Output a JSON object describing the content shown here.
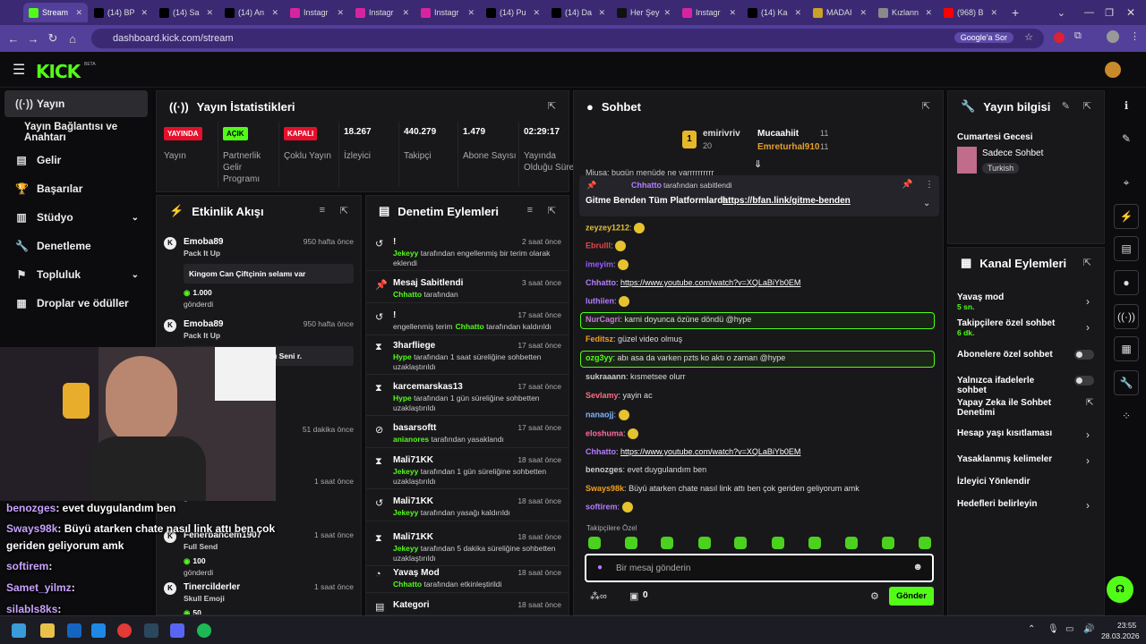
{
  "browser": {
    "tabs": [
      {
        "label": "Stream",
        "icon": "kick-icon",
        "color": "#53fc18",
        "active": true
      },
      {
        "label": "(14) BP",
        "icon": "x-icon",
        "color": "#000000"
      },
      {
        "label": "(14) Sa",
        "icon": "x-icon",
        "color": "#000000"
      },
      {
        "label": "(14) An",
        "icon": "x-icon",
        "color": "#000000"
      },
      {
        "label": "Instagr",
        "icon": "instagram-icon",
        "color": "#d6249f"
      },
      {
        "label": "Instagr",
        "icon": "instagram-icon",
        "color": "#d6249f"
      },
      {
        "label": "Instagr",
        "icon": "instagram-icon",
        "color": "#d6249f"
      },
      {
        "label": "(14) Pu",
        "icon": "x-icon",
        "color": "#000000"
      },
      {
        "label": "(14) Da",
        "icon": "x-icon",
        "color": "#000000"
      },
      {
        "label": "Her Şey",
        "icon": "tiktok-icon",
        "color": "#111111"
      },
      {
        "label": "Instagr",
        "icon": "instagram-icon",
        "color": "#d6249f"
      },
      {
        "label": "(14) Ka",
        "icon": "x-icon",
        "color": "#000000"
      },
      {
        "label": "MADAI",
        "icon": "doc-icon",
        "color": "#c9a227"
      },
      {
        "label": "Kızlann",
        "icon": "doc-icon",
        "color": "#8a8a8a"
      },
      {
        "label": "(968) B",
        "icon": "youtube-icon",
        "color": "#ff0000"
      }
    ],
    "url": "dashboard.kick.com/stream",
    "search_label": "Google'a Sor"
  },
  "sidebar": {
    "items": [
      {
        "label": "Yayın",
        "icon": "broadcast-icon",
        "selected": true
      },
      {
        "label": "Yayın Bağlantısı ve Anahtarı",
        "icon": ""
      },
      {
        "label": "Gelir",
        "icon": "gift-icon"
      },
      {
        "label": "Başarılar",
        "icon": "trophy-icon"
      },
      {
        "label": "Stüdyo",
        "icon": "studio-icon",
        "chevron": true
      },
      {
        "label": "Denetleme",
        "icon": "wrench-icon"
      },
      {
        "label": "Topluluk",
        "icon": "community-icon",
        "chevron": true
      },
      {
        "label": "Droplar ve ödüller",
        "icon": "gift-box-icon"
      }
    ]
  },
  "stats": {
    "title": "Yayın İstatistikleri",
    "items": [
      {
        "value": "YAYINDA",
        "label": "Yayın",
        "badge": true,
        "color": "#e5102b"
      },
      {
        "value": "AÇIK",
        "label": "Partnerlik Gelir Programı",
        "badge": true,
        "color": "#53fc18"
      },
      {
        "value": "KAPALI",
        "label": "Çoklu Yayın",
        "badge": true,
        "color": "#e5102b"
      },
      {
        "value": "18.267",
        "label": "İzleyici"
      },
      {
        "value": "440.279",
        "label": "Takipçi"
      },
      {
        "value": "1.479",
        "label": "Abone Sayısı"
      },
      {
        "value": "02:29:17",
        "label": "Yayında Olduğu Süre"
      }
    ]
  },
  "activity": {
    "title": "Etkinlik Akışı",
    "items": [
      {
        "name": "Emoba89",
        "time": "950 hafta önce",
        "sub": "Pack It Up",
        "msg": "Kingom Can Çiftçinin selamı var",
        "amount": "1.000",
        "sent": "gönderdi"
      },
      {
        "name": "Emoba89",
        "time": "950 hafta önce",
        "sub": "Pack It Up",
        "msg": "izleyen bi dı Can Çiftçi :) Seni r."
      },
      {
        "time": "51 dakika önce"
      },
      {
        "time": "1 saat önce",
        "amount": "100",
        "sent": "gönderdi"
      },
      {
        "name": "Fenerbahcem1907",
        "time": "1 saat önce",
        "sub": "Full Send",
        "amount": "100",
        "sent": "gönderdi"
      },
      {
        "name": "Tinercilderler",
        "time": "1 saat önce",
        "sub": "Skull Emoji",
        "amount": "50"
      }
    ]
  },
  "moderation": {
    "title": "Denetim Eylemleri",
    "items": [
      {
        "icon": "undo-icon",
        "name": "!",
        "time": "2 saat önce",
        "actor": "Jekeyy",
        "text": "tarafından engellenmiş bir terim olarak eklendi"
      },
      {
        "icon": "pin-icon",
        "name": "Mesaj Sabitlendi",
        "time": "3 saat önce",
        "actor": "Chhatto",
        "text": "tarafından"
      },
      {
        "icon": "undo-icon",
        "name": "!",
        "time": "17 saat önce",
        "actor": "",
        "pre": "engellenmiş terim",
        "actor2": "Chhatto",
        "text": "tarafından kaldırıldı"
      },
      {
        "icon": "hourglass-icon",
        "name": "3harfliege",
        "time": "17 saat önce",
        "actor": "Hype",
        "text": "tarafından 1 saat süreliğine sohbetten uzaklaştırıldı"
      },
      {
        "icon": "hourglass-icon",
        "name": "karcemarskas13",
        "time": "17 saat önce",
        "actor": "Hype",
        "text": "tarafından 1 gün süreliğine sohbetten uzaklaştırıldı"
      },
      {
        "icon": "ban-icon",
        "name": "basarsoftt",
        "time": "17 saat önce",
        "actor": "anianores",
        "text": "tarafından yasaklandı"
      },
      {
        "icon": "hourglass-icon",
        "name": "Mali71KK",
        "time": "18 saat önce",
        "actor": "Jekeyy",
        "text": "tarafından 1 gün süreliğine sohbetten uzaklaştırıldı"
      },
      {
        "icon": "undo-icon",
        "name": "Mali71KK",
        "time": "18 saat önce",
        "actor": "Jekeyy",
        "text": "tarafından yasağı kaldırıldı"
      },
      {
        "icon": "hourglass-icon",
        "name": "Mali71KK",
        "time": "18 saat önce",
        "actor": "Jekeyy",
        "text": "tarafından 5 dakika süreliğine sohbetten uzaklaştırıldı"
      },
      {
        "icon": "slow-icon",
        "name": "Yavaş Mod",
        "time": "18 saat önce",
        "actor": "Chhatto",
        "text": "tarafından etkinleştirildi"
      },
      {
        "icon": "category-icon",
        "name": "Kategori",
        "time": "18 saat önce"
      }
    ]
  },
  "chat": {
    "title": "Sohbet",
    "top": {
      "rank": "1",
      "user1": "emirivriv",
      "count1": "20",
      "user2": "Mucaahiit",
      "count2": "11",
      "user3": "Emreturhal910",
      "count3": "11"
    },
    "pinned": {
      "by": "Chhatto",
      "label": "tarafından sabitlendi",
      "text": "Gitme Benden Tüm Platformlarda:",
      "link": "https://bfan.link/gitme-benden"
    },
    "cut_line": "Miusa: bugün menüde ne varrrrrrrrrr",
    "messages": [
      {
        "user": "zeyzey1212",
        "color": "#e0c035",
        "text": ""
      },
      {
        "user": "Ebrulll",
        "color": "#e04848",
        "text": ""
      },
      {
        "user": "imeyim",
        "color": "#9b59ff",
        "text": ""
      },
      {
        "user": "Chhatto",
        "color": "#b57dff",
        "text": "https://www.youtube.com/watch?v=XQLaBiYb0EM",
        "link": true
      },
      {
        "user": "luthiien",
        "color": "#b57dff",
        "text": ""
      },
      {
        "user": "NurCagri",
        "color": "#c678dd",
        "text": "karni doyunca özüne döndü @hype",
        "highlight": true
      },
      {
        "user": "Feditsz",
        "color": "#f0a020",
        "text": "güzel video olmuş"
      },
      {
        "user": "ozg3yy",
        "color": "#53fc18",
        "text": "abı asa da varken pzts ko aktı o zaman @hype",
        "highlight": true
      },
      {
        "user": "sukraaann",
        "color": "#cccccc",
        "text": "kısmetsee olurr"
      },
      {
        "user": "Sevlamy",
        "color": "#ff6b81",
        "text": "yayin ac"
      },
      {
        "user": "nanaojj",
        "color": "#7fb3ff",
        "text": ""
      },
      {
        "user": "eloshuma",
        "color": "#ff6b9b",
        "text": ""
      },
      {
        "user": "Chhatto",
        "color": "#b57dff",
        "text": "https://www.youtube.com/watch?v=XQLaBiYb0EM",
        "link": true
      },
      {
        "user": "benozges",
        "color": "#cccccc",
        "text": "evet duygulandım ben"
      },
      {
        "user": "Sways98k",
        "color": "#f0a020",
        "text": "Büyü atarken chate nasıl link attı ben çok geriden geliyorum amk"
      },
      {
        "user": "softirem",
        "color": "#b57dff",
        "text": ""
      }
    ],
    "followers_label": "Takipçilere Özel",
    "input_placeholder": "Bir mesaj gönderin",
    "points": "0",
    "send_label": "Gönder"
  },
  "stream_info": {
    "title": "Yayın bilgisi",
    "stream_title": "Cumartesi Gecesi",
    "category": "Sadece Sohbet",
    "tag": "Turkish"
  },
  "channel": {
    "title": "Kanal Eylemleri",
    "items": [
      {
        "label": "Yavaş mod",
        "sub": "5 sn.",
        "type": "arrow"
      },
      {
        "label": "Takipçilere özel sohbet",
        "sub": "6 dk.",
        "type": "arrow"
      },
      {
        "label": "Abonelere özel sohbet",
        "type": "toggle"
      },
      {
        "label": "Yalnızca ifadelerle sohbet",
        "type": "toggle"
      },
      {
        "label": "Yapay Zeka ile Sohbet Denetimi",
        "type": "external"
      },
      {
        "label": "Hesap yaşı kısıtlaması",
        "type": "arrow"
      },
      {
        "label": "Yasaklanmış kelimeler",
        "type": "arrow"
      },
      {
        "label": "İzleyici Yönlendir",
        "type": "none"
      },
      {
        "label": "Hedefleri belirleyin",
        "type": "arrow"
      }
    ]
  },
  "overlay": {
    "lines": [
      {
        "user": "benozges",
        "text": ": evet duygulandım ben"
      },
      {
        "user": "Sways98k",
        "text": ": Büyü atarken chate nasıl link attı ben çok"
      },
      {
        "user": "",
        "text": "geriden geliyorum amk"
      },
      {
        "user": "softirem",
        "text": ":"
      },
      {
        "user": "Samet_yilmz",
        "text": ":"
      },
      {
        "user": "silabls8ks",
        "text": ":"
      }
    ]
  },
  "taskbar": {
    "time": "23:55",
    "date": "28.03.2026"
  }
}
